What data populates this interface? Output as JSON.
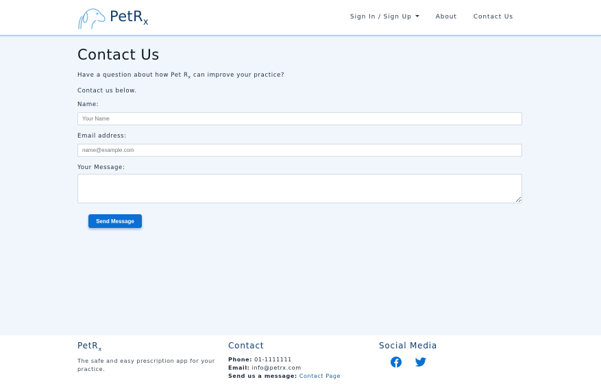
{
  "brand": {
    "name": "PetR",
    "sub": "x"
  },
  "nav": {
    "signin": "Sign In / Sign Up",
    "about": "About",
    "contact": "Contact Us"
  },
  "main": {
    "title": "Contact Us",
    "intro1_pre": "Have a question about how Pet R",
    "intro1_sub": "x",
    "intro1_post": " can improve your practice?",
    "intro2": "Contact us below.",
    "name_label": "Name:",
    "name_placeholder": "Your Name",
    "email_label": "Email address:",
    "email_placeholder": "name@example.com",
    "message_label": "Your Message:",
    "send_label": "Send Message"
  },
  "footer": {
    "about_title": "PetR",
    "about_title_sub": "x",
    "about_text": "The safe and easy prescription app for your practice.",
    "contact_title": "Contact",
    "phone_label": "Phone:",
    "phone_value": "01-1111111",
    "email_label": "Email:",
    "email_value": "info@petrx.com",
    "message_label": "Send us a message:",
    "message_link": "Contact Page",
    "social_title": "Social Media",
    "social_icons": [
      "facebook-icon",
      "twitter-icon"
    ]
  },
  "colors": {
    "brand": "#123c6d",
    "accent": "#0b6fd3",
    "background": "#f1f6fd",
    "link": "#1d5d9c"
  }
}
